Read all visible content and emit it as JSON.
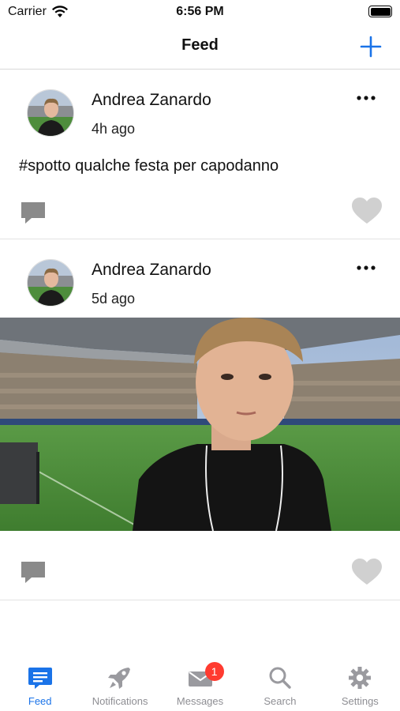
{
  "status_bar": {
    "carrier": "Carrier",
    "time": "6:56 PM"
  },
  "nav": {
    "title": "Feed",
    "add_icon": "plus-icon"
  },
  "posts": [
    {
      "author": "Andrea Zanardo",
      "time_ago": "4h ago",
      "text": "#spotto qualche festa per capodanno",
      "has_image": false
    },
    {
      "author": "Andrea Zanardo",
      "time_ago": "5d ago",
      "text": "",
      "has_image": true
    }
  ],
  "tabs": [
    {
      "label": "Feed",
      "icon": "feed-icon",
      "active": true
    },
    {
      "label": "Notifications",
      "icon": "rocket-icon",
      "active": false
    },
    {
      "label": "Messages",
      "icon": "envelope-icon",
      "active": false,
      "badge": "1"
    },
    {
      "label": "Search",
      "icon": "search-icon",
      "active": false
    },
    {
      "label": "Settings",
      "icon": "gear-icon",
      "active": false
    }
  ],
  "colors": {
    "accent": "#1a73e8",
    "tab_inactive": "#8e8e93",
    "badge": "#ff3b30",
    "action_gray": "#8a8a8a",
    "like_gray": "#d0d0d0"
  }
}
